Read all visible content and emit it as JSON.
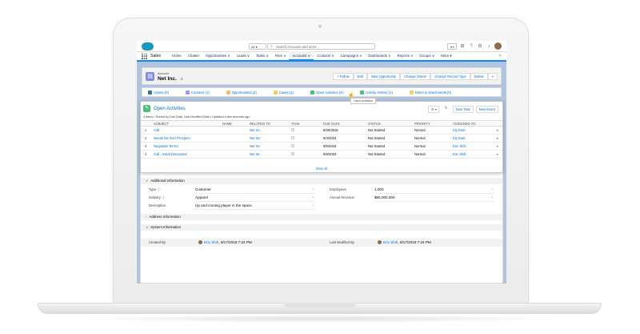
{
  "colors": {
    "brand": "#1798c1",
    "accent": "#1589ee",
    "link": "#0070d2",
    "background": "#b0c4df"
  },
  "topbar": {
    "scope": "All",
    "search_placeholder": "Search Accounts and more...",
    "icons": [
      "cloud-logo-icon",
      "search-icon",
      "favorites-icon",
      "add-icon",
      "help-icon",
      "setup-gear-icon",
      "notification-bell-icon",
      "user-avatar"
    ]
  },
  "nav": {
    "app_name": "Sales",
    "items": [
      "Home",
      "Chatter",
      "Opportunities ∨",
      "Leads ∨",
      "Tasks ∨",
      "Files ∨",
      "Accounts ∨",
      "Contacts ∨",
      "Campaigns ∨",
      "Dashboards ∨",
      "Reports ∨",
      "Groups ∨",
      "More ▾"
    ]
  },
  "record": {
    "type_label": "Account",
    "name": "Net Inc.",
    "follow_glyph": "♙",
    "actions": [
      "+ Follow",
      "Edit",
      "New Opportunity",
      "Change Owner",
      "Change Record Type",
      "Delete",
      "▾"
    ]
  },
  "related": [
    {
      "label": "Assets (0)",
      "color": "#317a92"
    },
    {
      "label": "Contacts (1)",
      "color": "#a094ed"
    },
    {
      "label": "Opportunities (2)",
      "color": "#fcb95b"
    },
    {
      "label": "Cases (1)",
      "color": "#f2cf5b"
    },
    {
      "label": "Open Activities (4)",
      "color": "#4bc076"
    },
    {
      "label": "Activity History (1)",
      "color": "#4bc076"
    },
    {
      "label": "Notes & Attachments (0)",
      "color": "#e6d478"
    }
  ],
  "tooltip": "Open Activities",
  "open_activities": {
    "title": "Open Activities",
    "subtitle": "4 items • Sorted by Due Date, Last Modified Date • Updated a few seconds ago",
    "buttons": {
      "gear": "⚙ ▾",
      "refresh": "↻",
      "new_task": "New Task",
      "new_event": "New Event"
    },
    "columns": [
      "",
      "SUBJECT",
      "NAME",
      "RELATED TO",
      "TASK",
      "DUE DATE",
      "STATUS",
      "PRIORITY",
      "ASSIGNED TO",
      ""
    ],
    "rows": [
      {
        "n": "1",
        "subject": "Call",
        "name": "",
        "related": "Net Inc",
        "due": "8/30/2018",
        "status": "Not Started",
        "priority": "Normal",
        "assigned": "Ely East"
      },
      {
        "n": "2",
        "subject": "Needs list from Prospect",
        "name": "",
        "related": "Net Inc",
        "due": "9/4/2018",
        "status": "Not Started",
        "priority": "Normal",
        "assigned": "Ely East"
      },
      {
        "n": "3",
        "subject": "Negotiate Terms",
        "name": "",
        "related": "Net Inc",
        "due": "9/5/2018",
        "status": "Not Started",
        "priority": "Normal",
        "assigned": "Eric Shih"
      },
      {
        "n": "4",
        "subject": "Call - Initial Discussion",
        "name": "",
        "related": "Net Inc",
        "due": "9/6/2018",
        "status": "Not Started",
        "priority": "Normal",
        "assigned": "Eric Shih"
      }
    ],
    "view_all": "View All"
  },
  "details": {
    "additional_header": "Additional Information",
    "type_label": "Type",
    "type_value": "Customer",
    "industry_label": "Industry",
    "industry_value": "Apparel",
    "description_label": "Description",
    "description_value": "Up and coming player in the space.",
    "employees_label": "Employees",
    "employees_value": "1,000",
    "revenue_label": "Annual Revenue",
    "revenue_value": "$85,000,000",
    "address_header": "Address Information",
    "system_header": "System Information",
    "created_label": "Created By",
    "created_user": "Eric Shih",
    "created_date": ", 8/17/2018 7:24 PM",
    "modified_label": "Last Modified By",
    "modified_user": "Eric Shih",
    "modified_date": ", 8/17/2018 7:24 PM"
  }
}
